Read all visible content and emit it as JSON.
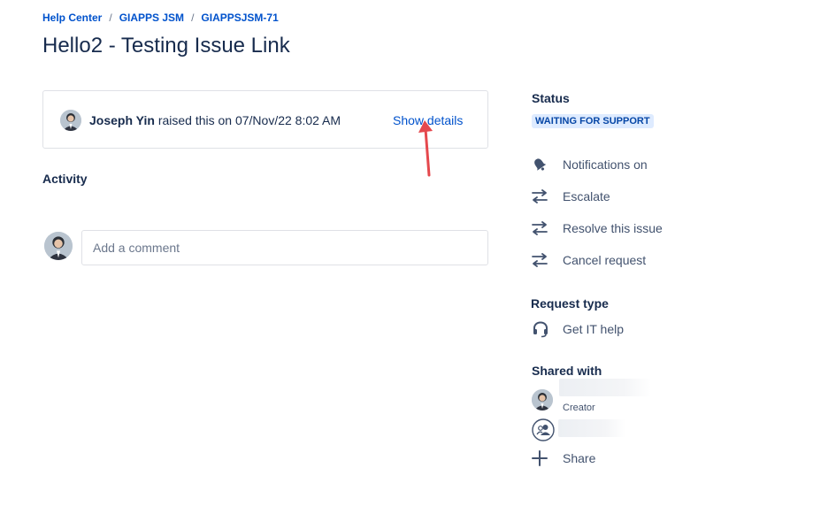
{
  "breadcrumb": {
    "items": [
      "Help Center",
      "GIAPPS JSM",
      "GIAPPSJSM-71"
    ],
    "separator": "/"
  },
  "page_title": "Hello2 - Testing Issue Link",
  "raised": {
    "user": "Joseph Yin",
    "text": "raised this on 07/Nov/22 8:02 AM",
    "show_details": "Show details"
  },
  "activity": {
    "heading": "Activity",
    "comment_placeholder": "Add a comment"
  },
  "sidebar": {
    "status_heading": "Status",
    "status_value": "WAITING FOR SUPPORT",
    "actions": [
      {
        "label": "Notifications on",
        "icon": "bell-icon"
      },
      {
        "label": "Escalate",
        "icon": "transition-icon"
      },
      {
        "label": "Resolve this issue",
        "icon": "transition-icon"
      },
      {
        "label": "Cancel request",
        "icon": "transition-icon"
      }
    ],
    "request_type_heading": "Request type",
    "request_type_value": "Get IT help",
    "request_type_icon": "headset-icon",
    "shared_heading": "Shared with",
    "creator_label": "Creator",
    "share_label": "Share"
  },
  "colors": {
    "link": "#0052cc",
    "text": "#172b4d",
    "lozenge_bg": "#deebff",
    "lozenge_text": "#0747a6",
    "arrow": "#e5484d"
  }
}
